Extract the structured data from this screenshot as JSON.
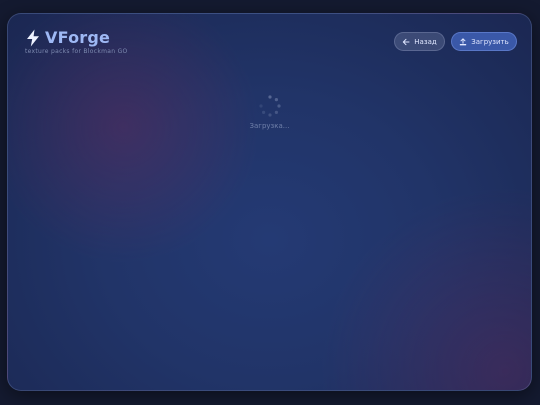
{
  "app": {
    "title": "VForge",
    "subtitle": "texture packs for Blockman GO",
    "logo_icon": "lightning-bolt-icon"
  },
  "toolbar": {
    "back_label": "Назад",
    "back_icon": "arrow-left-icon",
    "upload_label": "Загрузить",
    "upload_icon": "upload-icon"
  },
  "status": {
    "loading_text": "Загрузка..."
  },
  "colors": {
    "accent": "#9eb8f4",
    "primary_button": "#3a58a8",
    "background": "#213468",
    "bolt": "#eef2ff"
  }
}
